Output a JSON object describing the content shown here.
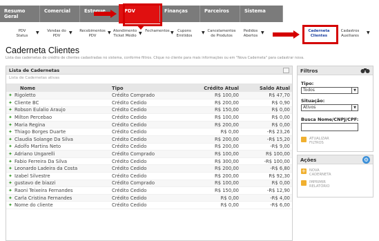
{
  "topnav": {
    "tabs": [
      {
        "label": "Resumo\nGeral"
      },
      {
        "label": "Comercial"
      },
      {
        "label": "Estoque"
      },
      {
        "label": "PDV"
      },
      {
        "label": "Finanças"
      },
      {
        "label": "Parceiros"
      },
      {
        "label": "Sistema"
      }
    ]
  },
  "subnav": {
    "items": [
      "PDV Status",
      "Vendas do PDV",
      "Recebimentos PDV",
      "Atendimento Ticket Médio",
      "Fechamentos",
      "Cupons Emitidos",
      "Cancelamentos de Produtos",
      "Pedidos Abertos",
      "Caderneta Clientes",
      "Cadastros Auxiliares"
    ]
  },
  "page": {
    "title": "Caderneta Clientes",
    "description": "Lista das cadernetas de crédito de clientes cadastradas no sistema, conforme filtros. Clique no cliente para mais informações ou em \"Nova Caderneta\" para cadastrar nova."
  },
  "list": {
    "title": "Lista de Cadernetas",
    "subtitle": "Lista de Cadernetas ativas",
    "columns": {
      "nome": "Nome",
      "tipo": "Tipo",
      "credito": "Crédito Atual",
      "saldo": "Saldo Atual"
    },
    "rows": [
      {
        "nome": "Rigoletto",
        "tipo": "Crédito Comprado",
        "credito": "R$ 100,00",
        "saldo": "R$ 47,70"
      },
      {
        "nome": "Cliente BC",
        "tipo": "Crédito Cedido",
        "credito": "R$ 200,00",
        "saldo": "R$ 0,90"
      },
      {
        "nome": "Robson Eulalio Araujo",
        "tipo": "Crédito Cedido",
        "credito": "R$ 150,00",
        "saldo": "R$ 0,00"
      },
      {
        "nome": "Milton Percebao",
        "tipo": "Crédito Cedido",
        "credito": "R$ 100,00",
        "saldo": "R$ 0,00"
      },
      {
        "nome": "Maria Regina",
        "tipo": "Crédito Cedido",
        "credito": "R$ 200,00",
        "saldo": "R$ 0,00"
      },
      {
        "nome": "Thiago Borges Duarte",
        "tipo": "Crédito Cedido",
        "credito": "R$ 0,00",
        "saldo": "-R$ 23,26"
      },
      {
        "nome": "Claudia Solange Da Silva",
        "tipo": "Crédito Cedido",
        "credito": "R$ 200,00",
        "saldo": "-R$ 15,20"
      },
      {
        "nome": "Adolfo Martins Neto",
        "tipo": "Crédito Cedido",
        "credito": "R$ 200,00",
        "saldo": "-R$ 9,00"
      },
      {
        "nome": "Adriano Ungarelli",
        "tipo": "Crédito Comprado",
        "credito": "R$ 100,00",
        "saldo": "R$ 100,00"
      },
      {
        "nome": "Fabio Ferreira Da Silva",
        "tipo": "Crédito Cedido",
        "credito": "R$ 300,00",
        "saldo": "-R$ 100,00"
      },
      {
        "nome": "Leonardo Ladeira da Costa",
        "tipo": "Crédito Cedido",
        "credito": "R$ 200,00",
        "saldo": "-R$ 6,80"
      },
      {
        "nome": "Izabel Silvestre",
        "tipo": "Crédito Cedido",
        "credito": "R$ 200,00",
        "saldo": "R$ 92,30"
      },
      {
        "nome": "gustavo de biazzi",
        "tipo": "Crédito Comprado",
        "credito": "R$ 100,00",
        "saldo": "R$ 0,00"
      },
      {
        "nome": "Raoni Teixeira Fernandes",
        "tipo": "Crédito Cedido",
        "credito": "R$ 150,00",
        "saldo": "-R$ 12,90"
      },
      {
        "nome": "Carla Cristina Fernandes",
        "tipo": "Crédito Cedido",
        "credito": "R$ 0,00",
        "saldo": "-R$ 4,00"
      },
      {
        "nome": "Nome do cliente",
        "tipo": "Crédito Cedido",
        "credito": "R$ 0,00",
        "saldo": "-R$ 6,00"
      }
    ]
  },
  "filters": {
    "title": "Filtros",
    "tipo_label": "Tipo:",
    "tipo_value": "Todos",
    "situacao_label": "Situação:",
    "situacao_value": "Ativos",
    "busca_label": "Busca Nome/CNPJ/CPF:",
    "busca_value": "",
    "update_label": "ATUALIZAR FILTROS"
  },
  "actions": {
    "title": "Ações",
    "nova_label": "NOVA CADERNETA",
    "imprimir_label": "IMPRIMIR RELATÓRIO"
  },
  "colors": {
    "nav_bg": "#7b7b7b",
    "active_tab": "#e01010",
    "highlight": "#d40000",
    "leaf": "#3a9a2a"
  }
}
